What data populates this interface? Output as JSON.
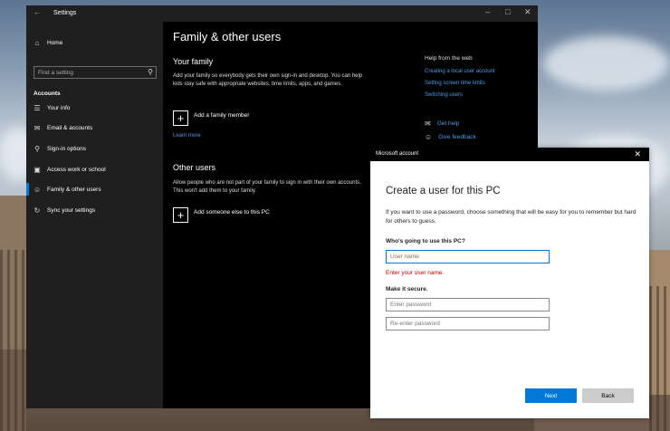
{
  "settings": {
    "window_title": "Settings",
    "home_label": "Home",
    "search_placeholder": "Find a setting",
    "section_label": "Accounts",
    "nav": [
      {
        "label": "Your info"
      },
      {
        "label": "Email & accounts"
      },
      {
        "label": "Sign-in options"
      },
      {
        "label": "Access work or school"
      },
      {
        "label": "Family & other users"
      },
      {
        "label": "Sync your settings"
      }
    ],
    "page_title": "Family & other users",
    "your_family": {
      "heading": "Your family",
      "text": "Add your family so everybody gets their own sign-in and desktop. You can help kids stay safe with appropriate websites, time limits, apps, and games.",
      "add_label": "Add a family member",
      "learn_more": "Learn more"
    },
    "other_users": {
      "heading": "Other users",
      "text": "Allow people who are not part of your family to sign in with their own accounts. This won't add them to your family.",
      "add_label": "Add someone else to this PC"
    },
    "help": {
      "title": "Help from the web",
      "links": [
        "Creating a local user account",
        "Setting screen time limits",
        "Switching users"
      ],
      "get_help": "Get help",
      "give_feedback": "Give feedback"
    }
  },
  "dialog": {
    "window_title": "Microsoft account",
    "heading": "Create a user for this PC",
    "description": "If you want to use a password, choose something that will be easy for you to remember but hard for others to guess.",
    "who_label": "Who's going to use this PC?",
    "username_placeholder": "User name",
    "error": "Enter your user name.",
    "secure_label": "Make it secure.",
    "password_placeholder": "Enter password",
    "reenter_placeholder": "Re-enter password",
    "next_label": "Next",
    "back_label": "Back"
  },
  "colors": {
    "accent": "#0078d7",
    "link": "#4d9de8",
    "error": "#c00000"
  }
}
